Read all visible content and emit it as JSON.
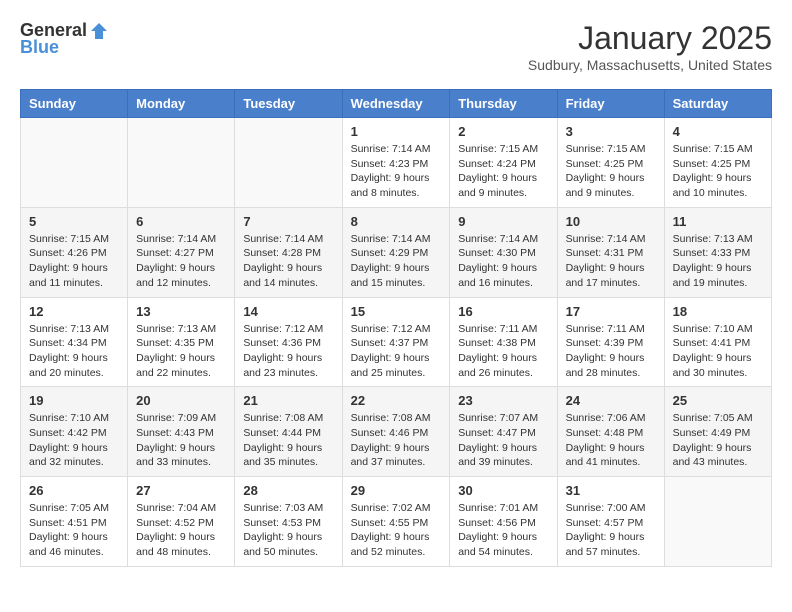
{
  "header": {
    "logo_general": "General",
    "logo_blue": "Blue",
    "month_title": "January 2025",
    "subtitle": "Sudbury, Massachusetts, United States"
  },
  "weekdays": [
    "Sunday",
    "Monday",
    "Tuesday",
    "Wednesday",
    "Thursday",
    "Friday",
    "Saturday"
  ],
  "weeks": [
    [
      {
        "day": "",
        "info": ""
      },
      {
        "day": "",
        "info": ""
      },
      {
        "day": "",
        "info": ""
      },
      {
        "day": "1",
        "info": "Sunrise: 7:14 AM\nSunset: 4:23 PM\nDaylight: 9 hours and 8 minutes."
      },
      {
        "day": "2",
        "info": "Sunrise: 7:15 AM\nSunset: 4:24 PM\nDaylight: 9 hours and 9 minutes."
      },
      {
        "day": "3",
        "info": "Sunrise: 7:15 AM\nSunset: 4:25 PM\nDaylight: 9 hours and 9 minutes."
      },
      {
        "day": "4",
        "info": "Sunrise: 7:15 AM\nSunset: 4:25 PM\nDaylight: 9 hours and 10 minutes."
      }
    ],
    [
      {
        "day": "5",
        "info": "Sunrise: 7:15 AM\nSunset: 4:26 PM\nDaylight: 9 hours and 11 minutes."
      },
      {
        "day": "6",
        "info": "Sunrise: 7:14 AM\nSunset: 4:27 PM\nDaylight: 9 hours and 12 minutes."
      },
      {
        "day": "7",
        "info": "Sunrise: 7:14 AM\nSunset: 4:28 PM\nDaylight: 9 hours and 14 minutes."
      },
      {
        "day": "8",
        "info": "Sunrise: 7:14 AM\nSunset: 4:29 PM\nDaylight: 9 hours and 15 minutes."
      },
      {
        "day": "9",
        "info": "Sunrise: 7:14 AM\nSunset: 4:30 PM\nDaylight: 9 hours and 16 minutes."
      },
      {
        "day": "10",
        "info": "Sunrise: 7:14 AM\nSunset: 4:31 PM\nDaylight: 9 hours and 17 minutes."
      },
      {
        "day": "11",
        "info": "Sunrise: 7:13 AM\nSunset: 4:33 PM\nDaylight: 9 hours and 19 minutes."
      }
    ],
    [
      {
        "day": "12",
        "info": "Sunrise: 7:13 AM\nSunset: 4:34 PM\nDaylight: 9 hours and 20 minutes."
      },
      {
        "day": "13",
        "info": "Sunrise: 7:13 AM\nSunset: 4:35 PM\nDaylight: 9 hours and 22 minutes."
      },
      {
        "day": "14",
        "info": "Sunrise: 7:12 AM\nSunset: 4:36 PM\nDaylight: 9 hours and 23 minutes."
      },
      {
        "day": "15",
        "info": "Sunrise: 7:12 AM\nSunset: 4:37 PM\nDaylight: 9 hours and 25 minutes."
      },
      {
        "day": "16",
        "info": "Sunrise: 7:11 AM\nSunset: 4:38 PM\nDaylight: 9 hours and 26 minutes."
      },
      {
        "day": "17",
        "info": "Sunrise: 7:11 AM\nSunset: 4:39 PM\nDaylight: 9 hours and 28 minutes."
      },
      {
        "day": "18",
        "info": "Sunrise: 7:10 AM\nSunset: 4:41 PM\nDaylight: 9 hours and 30 minutes."
      }
    ],
    [
      {
        "day": "19",
        "info": "Sunrise: 7:10 AM\nSunset: 4:42 PM\nDaylight: 9 hours and 32 minutes."
      },
      {
        "day": "20",
        "info": "Sunrise: 7:09 AM\nSunset: 4:43 PM\nDaylight: 9 hours and 33 minutes."
      },
      {
        "day": "21",
        "info": "Sunrise: 7:08 AM\nSunset: 4:44 PM\nDaylight: 9 hours and 35 minutes."
      },
      {
        "day": "22",
        "info": "Sunrise: 7:08 AM\nSunset: 4:46 PM\nDaylight: 9 hours and 37 minutes."
      },
      {
        "day": "23",
        "info": "Sunrise: 7:07 AM\nSunset: 4:47 PM\nDaylight: 9 hours and 39 minutes."
      },
      {
        "day": "24",
        "info": "Sunrise: 7:06 AM\nSunset: 4:48 PM\nDaylight: 9 hours and 41 minutes."
      },
      {
        "day": "25",
        "info": "Sunrise: 7:05 AM\nSunset: 4:49 PM\nDaylight: 9 hours and 43 minutes."
      }
    ],
    [
      {
        "day": "26",
        "info": "Sunrise: 7:05 AM\nSunset: 4:51 PM\nDaylight: 9 hours and 46 minutes."
      },
      {
        "day": "27",
        "info": "Sunrise: 7:04 AM\nSunset: 4:52 PM\nDaylight: 9 hours and 48 minutes."
      },
      {
        "day": "28",
        "info": "Sunrise: 7:03 AM\nSunset: 4:53 PM\nDaylight: 9 hours and 50 minutes."
      },
      {
        "day": "29",
        "info": "Sunrise: 7:02 AM\nSunset: 4:55 PM\nDaylight: 9 hours and 52 minutes."
      },
      {
        "day": "30",
        "info": "Sunrise: 7:01 AM\nSunset: 4:56 PM\nDaylight: 9 hours and 54 minutes."
      },
      {
        "day": "31",
        "info": "Sunrise: 7:00 AM\nSunset: 4:57 PM\nDaylight: 9 hours and 57 minutes."
      },
      {
        "day": "",
        "info": ""
      }
    ]
  ]
}
